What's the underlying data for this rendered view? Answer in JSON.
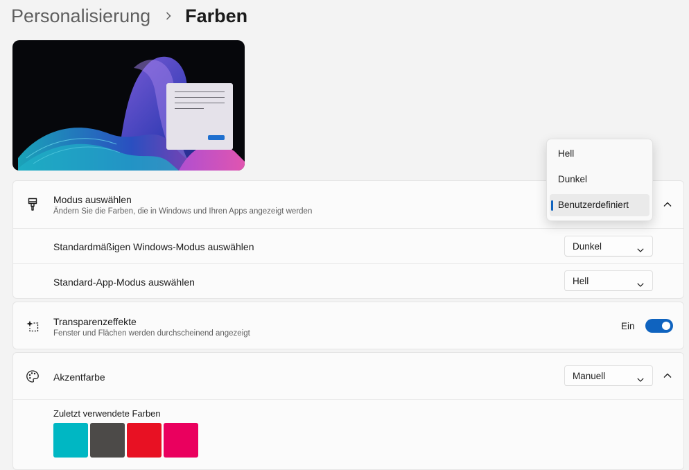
{
  "breadcrumb": {
    "parent": "Personalisierung",
    "current": "Farben"
  },
  "mode_card": {
    "title": "Modus auswählen",
    "subtitle": "Ändern Sie die Farben, die in Windows und Ihren Apps angezeigt werden",
    "icon": "paintbrush-icon",
    "expanded": true,
    "windows_mode": {
      "label": "Standardmäßigen Windows-Modus auswählen",
      "value": "Dunkel"
    },
    "app_mode": {
      "label": "Standard-App-Modus auswählen",
      "value": "Hell"
    }
  },
  "mode_dropdown": {
    "options": [
      "Hell",
      "Dunkel",
      "Benutzerdefiniert"
    ],
    "selected": "Benutzerdefiniert"
  },
  "transparency_card": {
    "title": "Transparenzeffekte",
    "subtitle": "Fenster und Flächen werden durchscheinend angezeigt",
    "icon": "transparency-sparkle-icon",
    "toggle_label": "Ein",
    "toggle_on": true
  },
  "accent_card": {
    "title": "Akzentfarbe",
    "icon": "palette-icon",
    "value": "Manuell",
    "expanded": true,
    "recent_label": "Zuletzt verwendete Farben",
    "recent_colors": [
      "#00b7c3",
      "#4c4a48",
      "#e81123",
      "#ea005e"
    ]
  },
  "colors": {
    "accent": "#0f63bf"
  }
}
